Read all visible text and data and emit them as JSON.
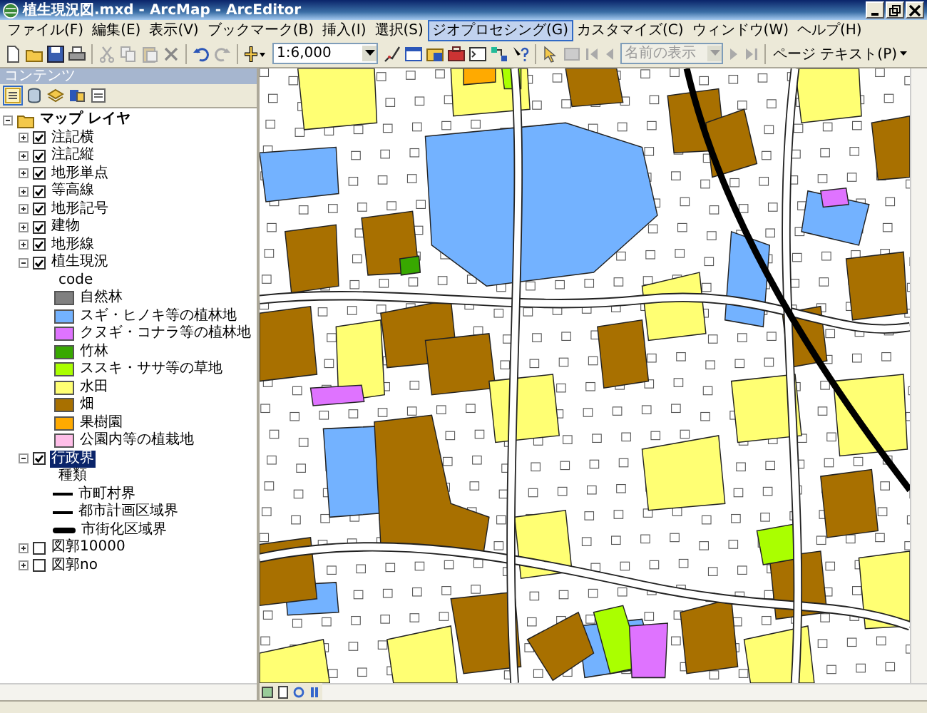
{
  "window": {
    "title": "植生現況図.mxd - ArcMap - ArcEditor"
  },
  "menu": [
    {
      "label": "ファイル(F)",
      "selected": false
    },
    {
      "label": "編集(E)",
      "selected": false
    },
    {
      "label": "表示(V)",
      "selected": false
    },
    {
      "label": "ブックマーク(B)",
      "selected": false
    },
    {
      "label": "挿入(I)",
      "selected": false
    },
    {
      "label": "選択(S)",
      "selected": false
    },
    {
      "label": "ジオプロセシング(G)",
      "selected": true
    },
    {
      "label": "カスタマイズ(C)",
      "selected": false
    },
    {
      "label": "ウィンドウ(W)",
      "selected": false
    },
    {
      "label": "ヘルプ(H)",
      "selected": false
    }
  ],
  "toolbar": {
    "scale": "1:6,000"
  },
  "layout_toolbar": {
    "feature_field": {
      "value": "名前の表示",
      "disabled": true
    },
    "page_text": "ページ テキスト(P)"
  },
  "toc": {
    "title": "コンテンツ",
    "tree": [
      {
        "kind": "map",
        "label": "マップ レイヤ",
        "expanded": true,
        "children": [
          {
            "kind": "layer",
            "label": "注記横",
            "checked": true,
            "expanded": false,
            "selected": false
          },
          {
            "kind": "layer",
            "label": "注記縦",
            "checked": true,
            "expanded": false,
            "selected": false
          },
          {
            "kind": "layer",
            "label": "地形単点",
            "checked": true,
            "expanded": false,
            "selected": false
          },
          {
            "kind": "layer",
            "label": "等高線",
            "checked": true,
            "expanded": false,
            "selected": false
          },
          {
            "kind": "layer",
            "label": "地形記号",
            "checked": true,
            "expanded": false,
            "selected": false
          },
          {
            "kind": "layer",
            "label": "建物",
            "checked": true,
            "expanded": false,
            "selected": false
          },
          {
            "kind": "layer",
            "label": "地形線",
            "checked": true,
            "expanded": false,
            "selected": false
          },
          {
            "kind": "layer",
            "label": "植生現況",
            "checked": true,
            "expanded": true,
            "selected": false,
            "children": [
              {
                "kind": "heading",
                "label": "code"
              },
              {
                "kind": "fill",
                "label": "自然林",
                "color": "#808080"
              },
              {
                "kind": "fill",
                "label": "スギ・ヒノキ等の植林地",
                "color": "#73b2ff"
              },
              {
                "kind": "fill",
                "label": "クヌギ・コナラ等の植林地",
                "color": "#df73ff"
              },
              {
                "kind": "fill",
                "label": "竹林",
                "color": "#38a800"
              },
              {
                "kind": "fill",
                "label": "ススキ・ササ等の草地",
                "color": "#aaff00"
              },
              {
                "kind": "fill",
                "label": "水田",
                "color": "#ffff73"
              },
              {
                "kind": "fill",
                "label": "畑",
                "color": "#a87000"
              },
              {
                "kind": "fill",
                "label": "果樹園",
                "color": "#ffaa00"
              },
              {
                "kind": "fill",
                "label": "公園内等の植栽地",
                "color": "#ffbee8"
              }
            ]
          },
          {
            "kind": "layer",
            "label": "行政界",
            "checked": true,
            "expanded": true,
            "selected": true,
            "children": [
              {
                "kind": "heading",
                "label": "種類"
              },
              {
                "kind": "line",
                "label": "市町村界"
              },
              {
                "kind": "line",
                "label": "都市計画区域界"
              },
              {
                "kind": "thick-line",
                "label": "市街化区域界"
              }
            ]
          },
          {
            "kind": "layer",
            "label": "図郭10000",
            "checked": false,
            "expanded": false,
            "selected": false
          },
          {
            "kind": "layer",
            "label": "図郭no",
            "checked": false,
            "expanded": false,
            "selected": false
          }
        ]
      }
    ]
  }
}
